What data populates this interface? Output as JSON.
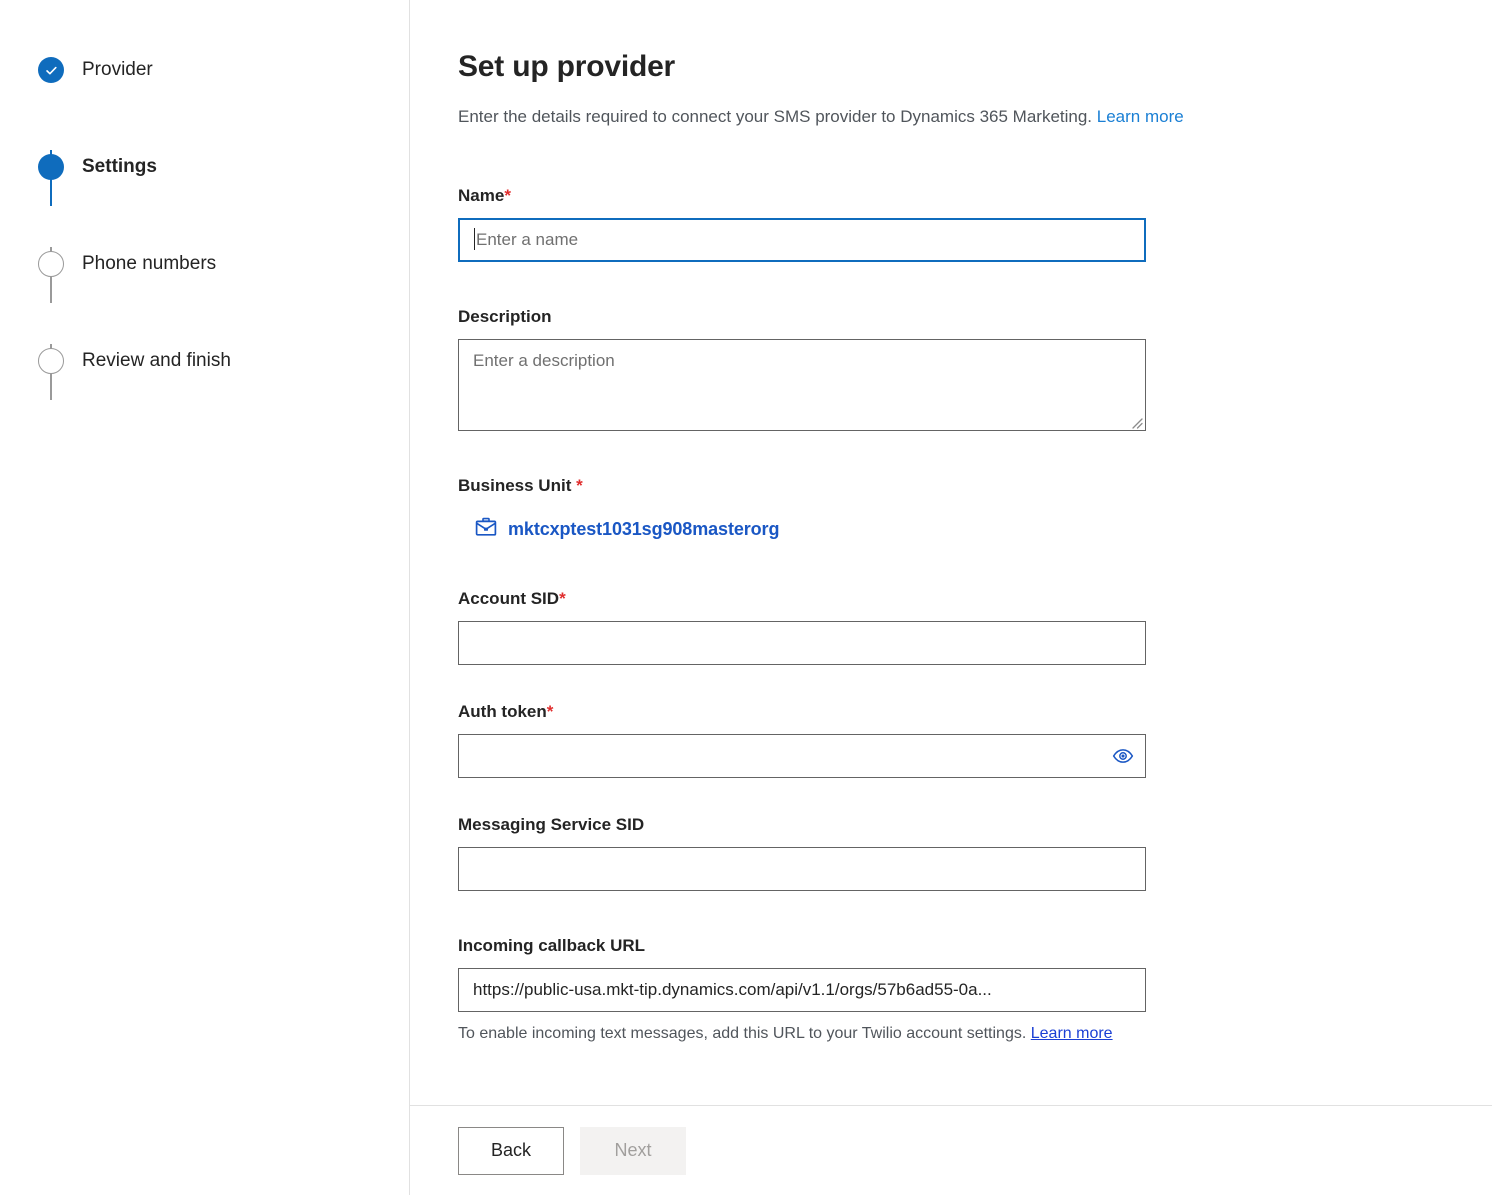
{
  "wizard": {
    "steps": [
      {
        "label": "Provider",
        "state": "completed",
        "icon": "check-icon"
      },
      {
        "label": "Settings",
        "state": "active",
        "icon": "filled-circle-icon"
      },
      {
        "label": "Phone numbers",
        "state": "todo",
        "icon": "empty-circle-icon"
      },
      {
        "label": "Review and finish",
        "state": "todo",
        "icon": "empty-circle-icon"
      }
    ]
  },
  "header": {
    "title": "Set up provider",
    "subtitle": "Enter the details required to connect your SMS provider to Dynamics 365 Marketing.",
    "learn_more": "Learn more"
  },
  "form": {
    "name": {
      "label": "Name",
      "required_marker": "*",
      "placeholder": "Enter a name",
      "value": ""
    },
    "description": {
      "label": "Description",
      "placeholder": "Enter a description",
      "value": ""
    },
    "business_unit": {
      "label": "Business Unit ",
      "required_marker": "*",
      "value": "mktcxptest1031sg908masterorg",
      "icon": "briefcase-icon"
    },
    "account_sid": {
      "label": "Account SID",
      "required_marker": "*",
      "value": "",
      "placeholder": ""
    },
    "auth_token": {
      "label": "Auth token",
      "required_marker": "*",
      "value": "",
      "placeholder": "",
      "reveal_icon": "eye-icon"
    },
    "messaging_service_sid": {
      "label": "Messaging Service SID",
      "value": "",
      "placeholder": ""
    },
    "incoming_callback_url": {
      "label": "Incoming callback URL",
      "value": "https://public-usa.mkt-tip.dynamics.com/api/v1.1/orgs/57b6ad55-0a...",
      "help_text": "To enable incoming text messages, add this URL to your Twilio account settings. ",
      "help_link": "Learn more"
    }
  },
  "footer": {
    "back_label": "Back",
    "next_label": "Next"
  },
  "colors": {
    "accent": "#0f6cbd",
    "link": "#1a7fd4",
    "required": "#e02d2d",
    "bu_link": "#1a57c4",
    "disabled_text": "#a19f9d"
  }
}
